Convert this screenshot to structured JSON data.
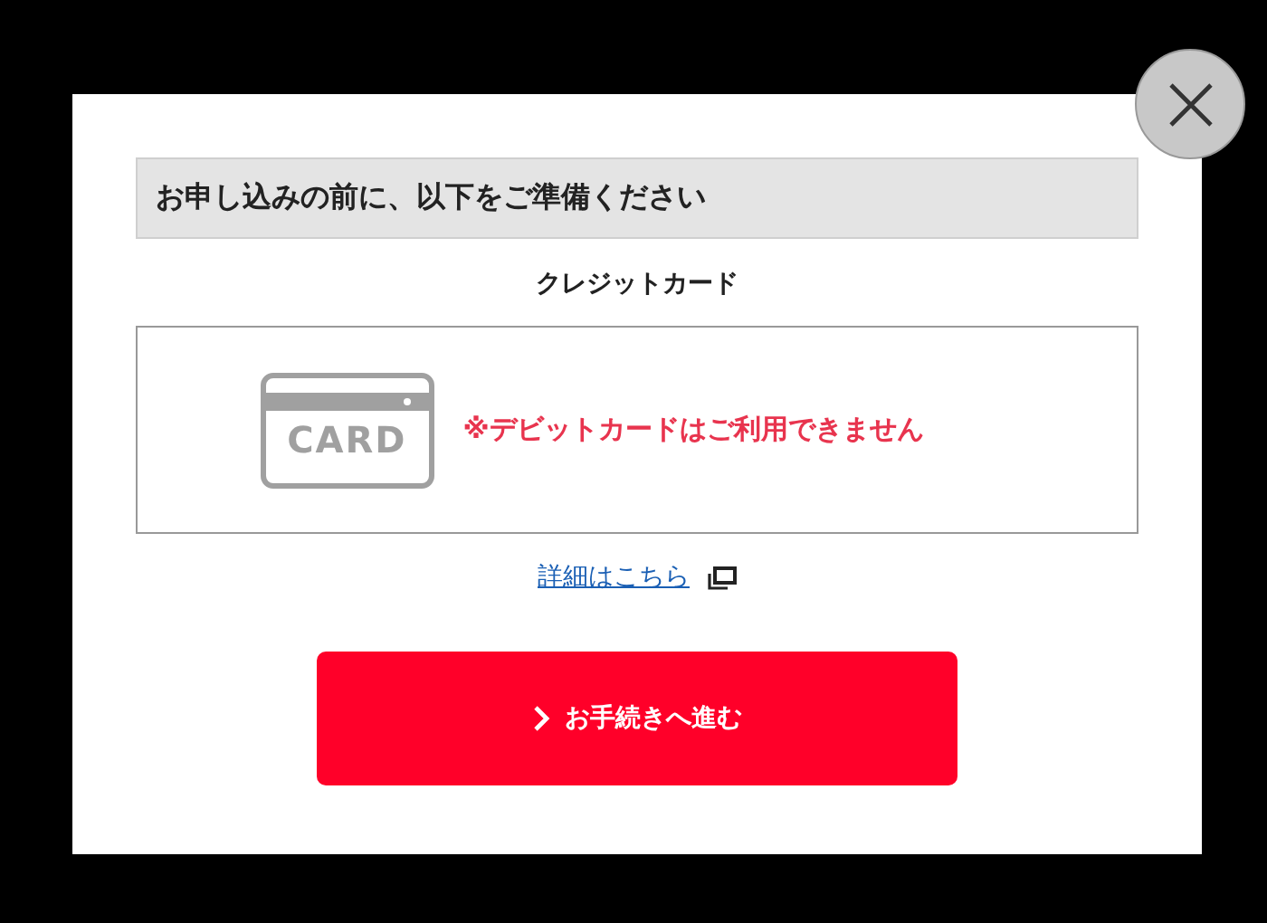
{
  "heading": "お申し込みの前に、以下をご準備ください",
  "item_title": "クレジットカード",
  "card_label": "CARD",
  "notice": "※デビットカードはご利用できません",
  "details_link": "詳細はこちら",
  "proceed_button": "お手続きへ進む"
}
